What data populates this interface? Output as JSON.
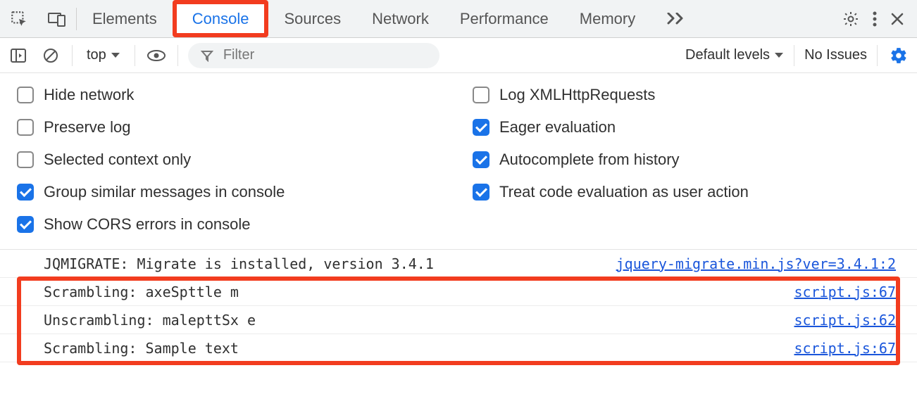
{
  "tabs": [
    "Elements",
    "Console",
    "Sources",
    "Network",
    "Performance",
    "Memory"
  ],
  "active_tab": 1,
  "toolbar": {
    "context": "top",
    "filter_placeholder": "Filter",
    "levels_label": "Default levels",
    "issues_label": "No Issues"
  },
  "settings": {
    "left": [
      {
        "label": "Hide network",
        "checked": false
      },
      {
        "label": "Preserve log",
        "checked": false
      },
      {
        "label": "Selected context only",
        "checked": false
      },
      {
        "label": "Group similar messages in console",
        "checked": true
      },
      {
        "label": "Show CORS errors in console",
        "checked": true
      }
    ],
    "right": [
      {
        "label": "Log XMLHttpRequests",
        "checked": false
      },
      {
        "label": "Eager evaluation",
        "checked": true
      },
      {
        "label": "Autocomplete from history",
        "checked": true
      },
      {
        "label": "Treat code evaluation as user action",
        "checked": true
      }
    ]
  },
  "logs": [
    {
      "msg": "JQMIGRATE: Migrate is installed, version 3.4.1",
      "src": "jquery-migrate.min.js?ver=3.4.1:2"
    },
    {
      "msg": "Scrambling: axeSpttle m",
      "src": "script.js:67"
    },
    {
      "msg": "Unscrambling: malepttSx e",
      "src": "script.js:62"
    },
    {
      "msg": "Scrambling: Sample text",
      "src": "script.js:67"
    }
  ]
}
